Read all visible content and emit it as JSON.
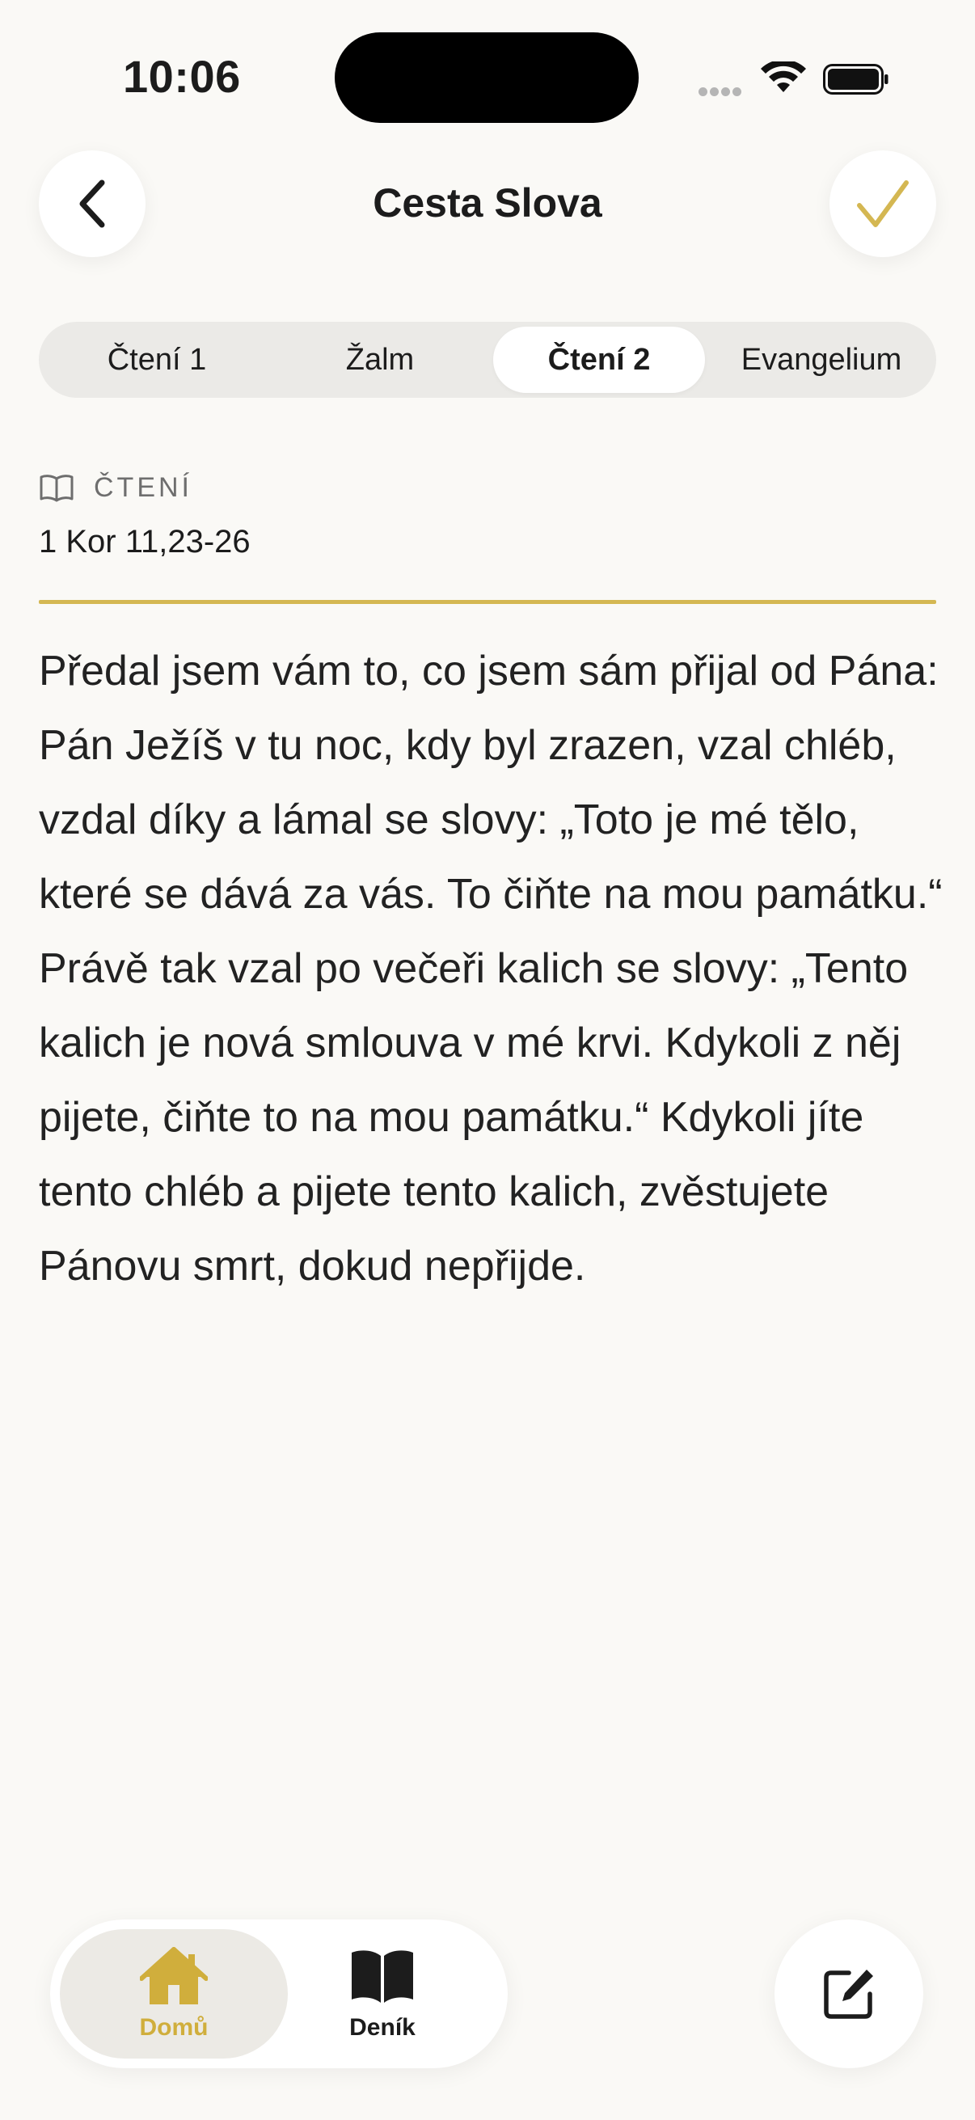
{
  "status_bar": {
    "time": "10:06"
  },
  "header": {
    "title": "Cesta Slova",
    "back_icon": "chevron-left-icon",
    "confirm_icon": "checkmark-icon",
    "accent": "#D4B752"
  },
  "tabs": [
    {
      "label": "Čtení 1",
      "active": false
    },
    {
      "label": "Žalm",
      "active": false
    },
    {
      "label": "Čtení 2",
      "active": true
    },
    {
      "label": "Evangelium",
      "active": false
    }
  ],
  "reading": {
    "section_icon": "book-icon",
    "section_label": "ČTENÍ",
    "reference": "1 Kor 11,23-26",
    "text": "Předal jsem vám to, co jsem sám přijal od Pána: Pán Ježíš v tu noc, kdy byl zrazen, vzal chléb, vzdal díky a lámal se slovy: „Toto je mé tělo, které se dává za vás. To čiňte na mou památku.“ Právě tak vzal po večeři kalich se slovy: „Tento kalich je nová smlouva v mé krvi. Kdykoli z něj pijete, čiňte to na mou památku.“ Kdykoli jíte tento chléb a pijete tento kalich, zvěstujete Pánovu smrt, dokud nepřijde."
  },
  "bottom_nav": {
    "items": [
      {
        "label": "Domů",
        "icon": "home-icon",
        "active": true
      },
      {
        "label": "Deník",
        "icon": "open-book-icon",
        "active": false
      }
    ],
    "compose_icon": "compose-icon"
  },
  "colors": {
    "background": "#FAF9F6",
    "accent_gold": "#D4B752",
    "active_tab_label": "#D0AE3C"
  }
}
